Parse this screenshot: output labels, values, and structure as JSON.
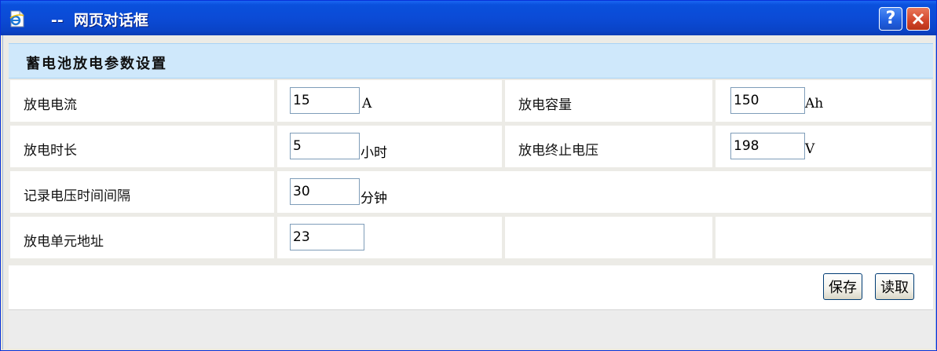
{
  "window": {
    "title": "   --  网页对话框"
  },
  "section": {
    "title": "蓄电池放电参数设置"
  },
  "fields": {
    "current": {
      "label": "放电电流",
      "value": "15",
      "unit": "A"
    },
    "capacity": {
      "label": "放电容量",
      "value": "150",
      "unit": "Ah"
    },
    "duration": {
      "label": "放电时长",
      "value": "5",
      "unit": "小时"
    },
    "cutoff": {
      "label": "放电终止电压",
      "value": "198",
      "unit": "V"
    },
    "interval": {
      "label": "记录电压时间间隔",
      "value": "30",
      "unit": "分钟"
    },
    "address": {
      "label": "放电单元地址",
      "value": "23"
    }
  },
  "buttons": {
    "save": "保存",
    "read": "读取"
  },
  "icons": {
    "app": "ie-page-icon",
    "help": "help-icon",
    "close": "close-icon"
  },
  "colors": {
    "titlebar": "#0a50dc",
    "header_bg": "#cfe8fb",
    "input_border": "#7f9db9",
    "close": "#d2452a"
  }
}
